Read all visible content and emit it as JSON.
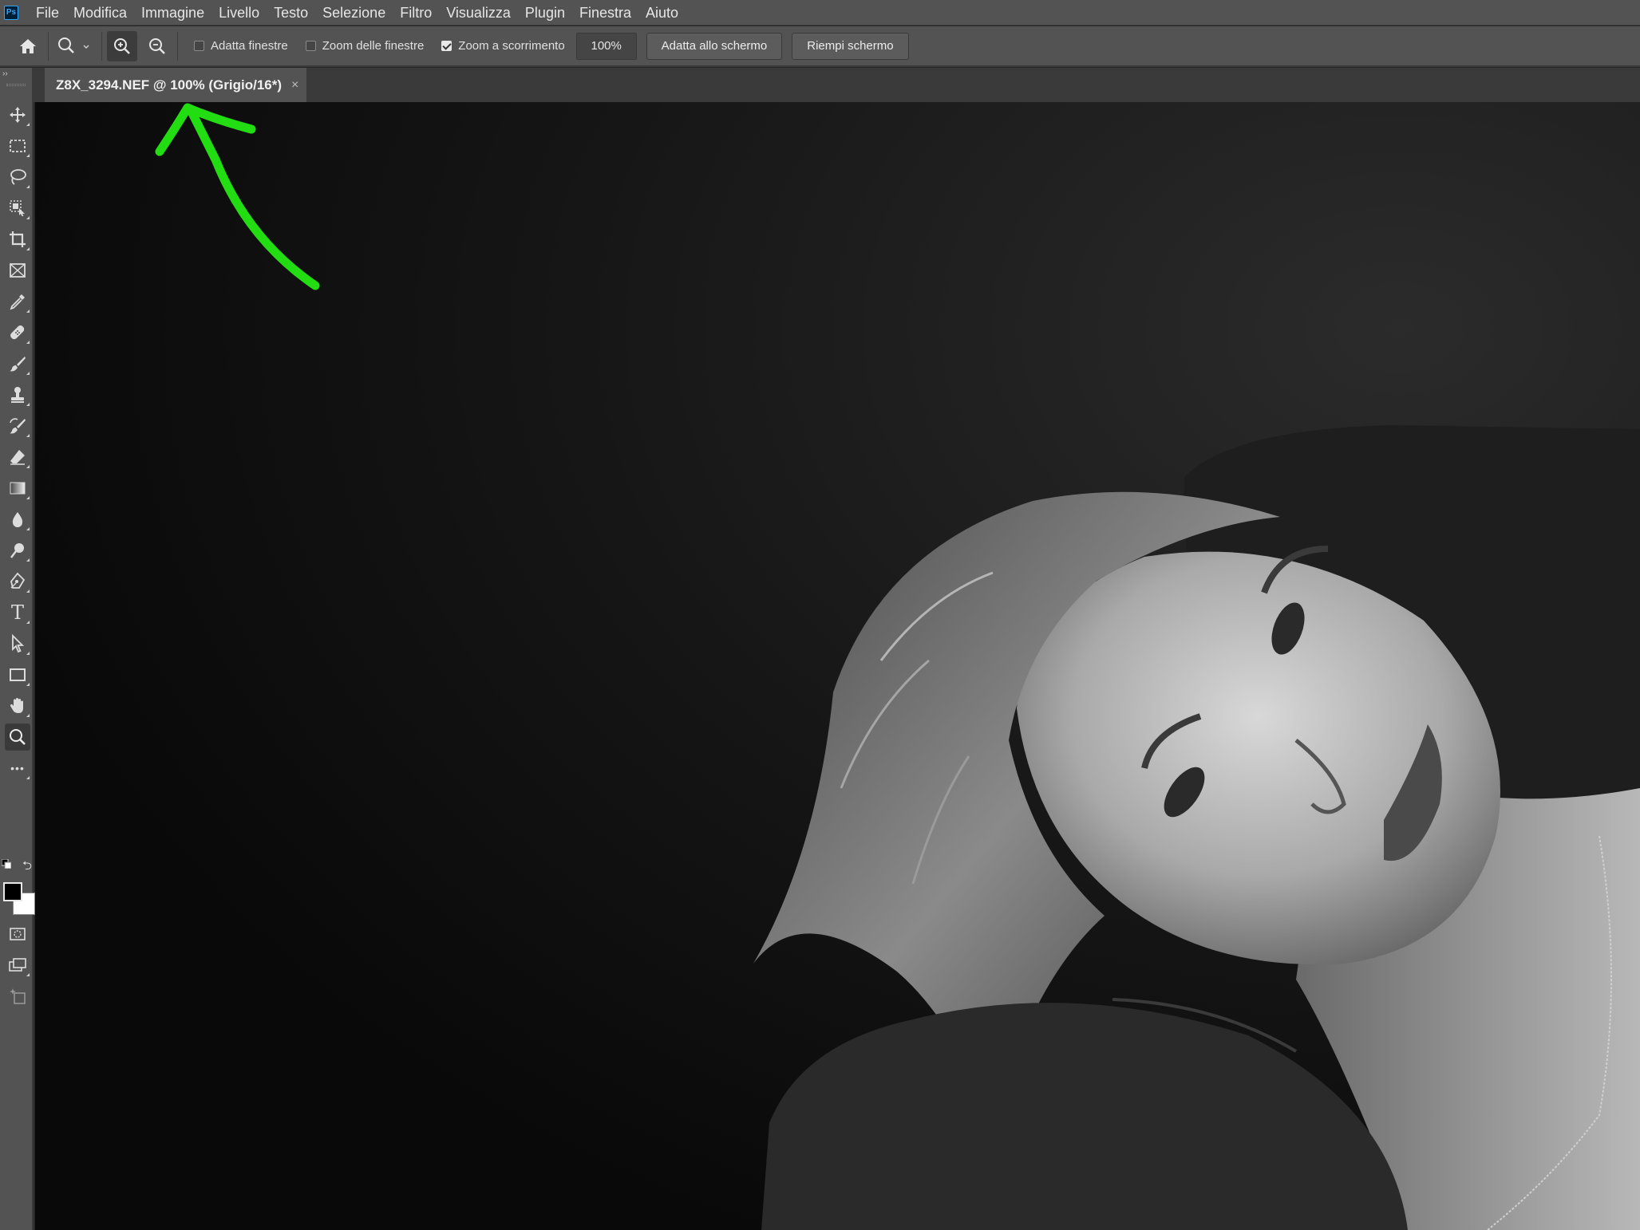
{
  "app": {
    "logo_text": "Ps"
  },
  "menu": [
    "File",
    "Modifica",
    "Immagine",
    "Livello",
    "Testo",
    "Selezione",
    "Filtro",
    "Visualizza",
    "Plugin",
    "Finestra",
    "Aiuto"
  ],
  "options": {
    "fit_windows_label": "Adatta finestre",
    "fit_windows_checked": false,
    "zoom_all_windows_label": "Zoom delle finestre",
    "zoom_all_windows_checked": false,
    "scrubby_zoom_label": "Zoom a scorrimento",
    "scrubby_zoom_checked": true,
    "zoom_value": "100%",
    "fit_screen_label": "Adatta allo schermo",
    "fill_screen_label": "Riempi schermo"
  },
  "document": {
    "tab_title": "Z8X_3294.NEF @ 100% (Grigio/16*)",
    "close_glyph": "×"
  },
  "toolbar": {
    "collapse_glyph": "››",
    "tools": [
      "move-icon",
      "marquee-icon",
      "lasso-icon",
      "object-select-icon",
      "crop-icon",
      "frame-icon",
      "eyedropper-icon",
      "healing-icon",
      "brush-icon",
      "stamp-icon",
      "history-brush-icon",
      "eraser-icon",
      "gradient-icon",
      "blur-icon",
      "dodge-icon",
      "pen-icon",
      "type-icon",
      "path-select-icon",
      "rectangle-icon",
      "hand-icon",
      "zoom-icon",
      "more-icon"
    ],
    "active_tool": "zoom-icon",
    "type_glyph": "T",
    "more_glyph": "•••",
    "swap_glyph": "⮌",
    "foreground_color": "#000000",
    "background_color": "#ffffff"
  },
  "colors": {
    "annotation_arrow": "#22dd11",
    "panel_bg": "#535353",
    "tab_bg": "#535353",
    "canvas_bg": "#0b0b0b"
  }
}
